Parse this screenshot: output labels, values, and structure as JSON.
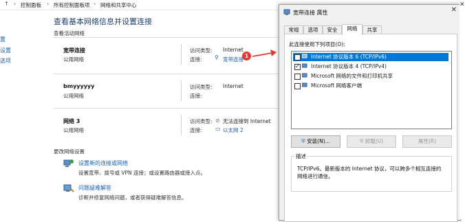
{
  "breadcrumb": {
    "items": [
      "控制面板",
      "所有控制面板项",
      "网络和共享中心"
    ]
  },
  "left_nav": {
    "items": [
      "置",
      "设置",
      "选项"
    ]
  },
  "main": {
    "title": "查看基本网络信息并设置连接",
    "active_networks_label": "查看活动网络",
    "change_settings_label": "更改网络设置",
    "access_type_label": "访问类型:",
    "connections_label": "连接:",
    "networks": [
      {
        "name": "宽带连接",
        "type": "公用网络",
        "access": "Internet",
        "connection": "宽带连接"
      },
      {
        "name": "bmyyyyyy",
        "type": "公用网络",
        "access": "Internet",
        "connection": ""
      },
      {
        "name": "网络 3",
        "type": "公用网络",
        "access": "无法连接到 Internet",
        "connection": "以太网 2"
      }
    ],
    "tasks": [
      {
        "link": "设置新的连接或网络",
        "desc": "设置宽带、拨号或 VPN 连接；或设置路由器或接入点。"
      },
      {
        "link": "问题疑难解答",
        "desc": "诊断并修复网络问题，或者获得疑难解答信息。"
      }
    ],
    "badge": "1"
  },
  "dialog": {
    "title": "宽带连接 属性",
    "close": "✕",
    "tabs": [
      "常规",
      "选项",
      "安全",
      "网络",
      "共享"
    ],
    "active_tab": "网络",
    "uses_label": "此连接使用下列项目(O):",
    "items": [
      {
        "label": "Internet 协议版本 6 (TCP/IPv6)",
        "checked": false,
        "selected": true
      },
      {
        "label": "Internet 协议版本 4 (TCP/IPv4)",
        "checked": true,
        "selected": false
      },
      {
        "label": "Microsoft 网络的文件和打印机共享",
        "checked": false,
        "selected": false
      },
      {
        "label": "Microsoft 网络客户端",
        "checked": false,
        "selected": false
      }
    ],
    "buttons": {
      "install": "安装(N)...",
      "uninstall": "卸载(U)",
      "properties": "属性(R)"
    },
    "description_label": "描述",
    "description_text": "TCP/IPv6。最新版本的 Internet 协议，可以跨多个相互连接的网络进行通信。"
  },
  "colors": {
    "accent": "#0078d7",
    "link": "#1a5fb4",
    "title": "#1e3d73",
    "badge": "#e53935",
    "arrow": "#e53935"
  }
}
